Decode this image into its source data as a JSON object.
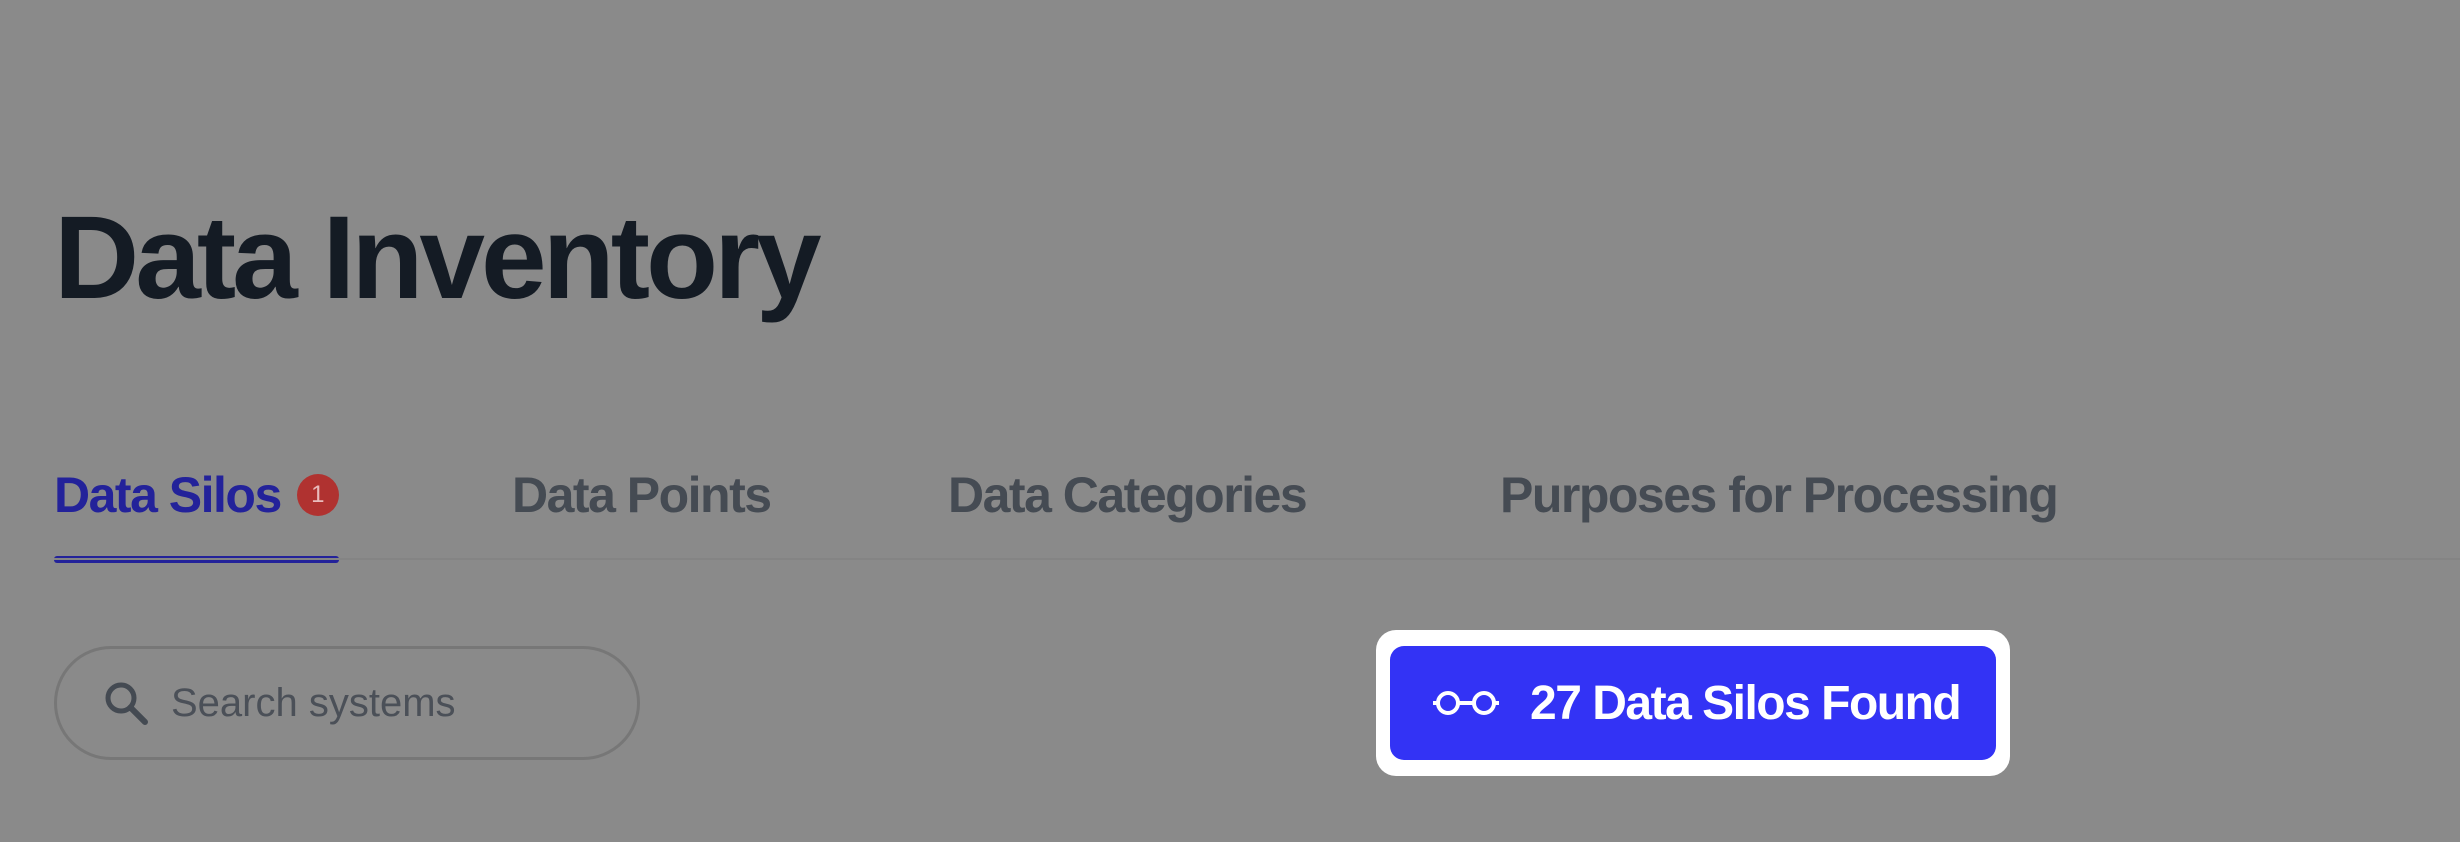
{
  "page": {
    "title": "Data Inventory",
    "background_color": "#8a8a8a"
  },
  "tabs": [
    {
      "label": "Data Silos",
      "active": true,
      "badge_count": "1"
    },
    {
      "label": "Data Points",
      "active": false
    },
    {
      "label": "Data Categories",
      "active": false
    },
    {
      "label": "Purposes for Processing",
      "active": false
    }
  ],
  "search": {
    "placeholder": "Search systems",
    "value": "",
    "icon": "search-icon"
  },
  "results": {
    "label": "27 Data Silos Found",
    "icon": "glasses-icon",
    "button_color": "#3333f5",
    "highlighted": true
  },
  "colors": {
    "active_tab": "#23229a",
    "inactive_tab": "#454b53",
    "badge": "#b03230",
    "title": "#141b24"
  }
}
